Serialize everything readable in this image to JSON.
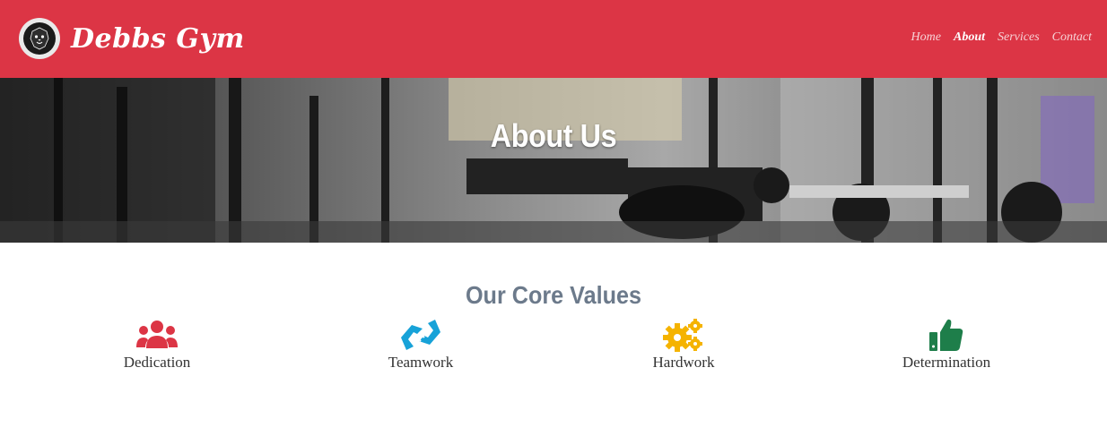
{
  "brand": {
    "name": "Debbs Gym",
    "logo": "lion-logo-icon"
  },
  "nav": {
    "items": [
      "Home",
      "About",
      "Services",
      "Contact"
    ],
    "active": "About"
  },
  "hero": {
    "title": "About Us"
  },
  "core_values": {
    "title": "Our Core Values",
    "items": [
      {
        "label": "Dedication",
        "icon": "users-icon",
        "color": "#dc3545"
      },
      {
        "label": "Teamwork",
        "icon": "handshake-icon",
        "color": "#17a2d8"
      },
      {
        "label": "Hardwork",
        "icon": "gears-icon",
        "color": "#f5b300"
      },
      {
        "label": "Determination",
        "icon": "thumbs-up-icon",
        "color": "#1e7e4a"
      }
    ]
  },
  "colors": {
    "navbar": "#dc3545",
    "title": "#6c7a8b"
  }
}
